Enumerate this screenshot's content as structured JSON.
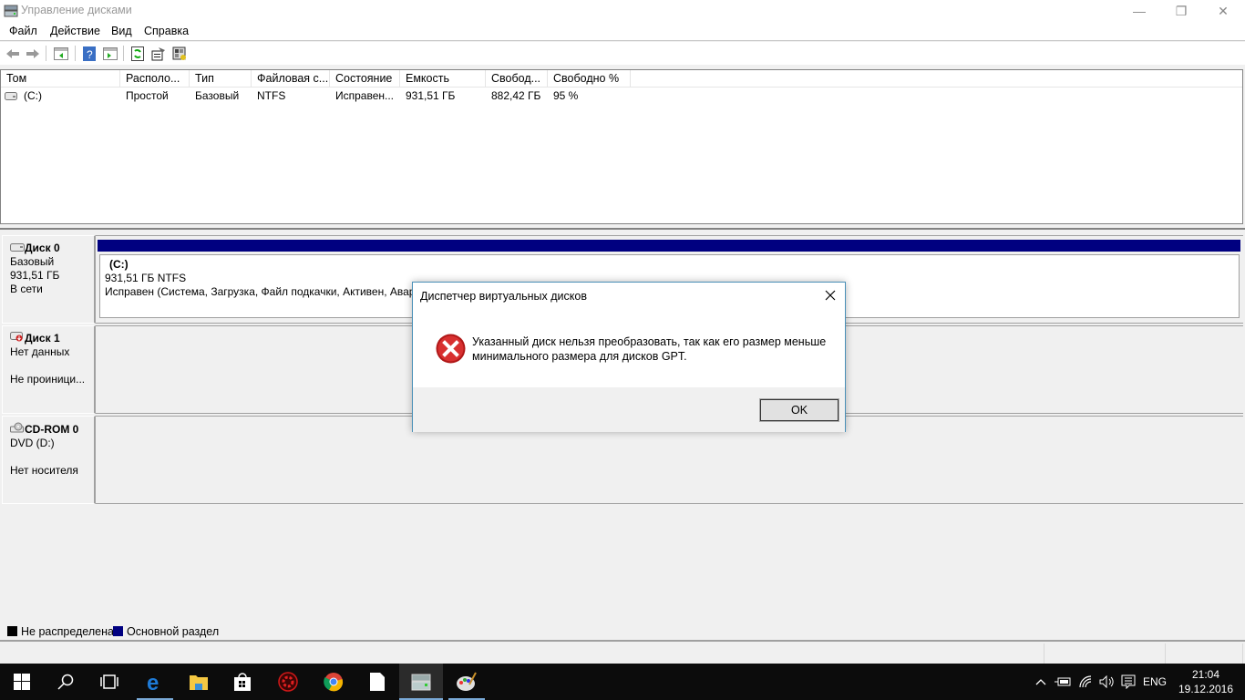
{
  "window": {
    "title": "Управление дисками",
    "controls": {
      "minimize": "—",
      "restore": "❐",
      "close": "✕"
    }
  },
  "menu": [
    "Файл",
    "Действие",
    "Вид",
    "Справка"
  ],
  "toolbar": {
    "icons": [
      "back-icon",
      "forward-icon",
      "show-hide-console-tree-icon",
      "help-icon",
      "show-hide-action-pane-icon",
      "refresh-icon",
      "properties-icon",
      "settings-icon"
    ]
  },
  "volume_list": {
    "columns": [
      "Том",
      "Располо...",
      "Тип",
      "Файловая с...",
      "Состояние",
      "Емкость",
      "Свобод...",
      "Свободно %"
    ],
    "rows": [
      {
        "volume": "(C:)",
        "layout": "Простой",
        "type": "Базовый",
        "fs": "NTFS",
        "status": "Исправен...",
        "capacity": "931,51 ГБ",
        "free": "882,42 ГБ",
        "free_pct": "95 %"
      }
    ]
  },
  "disks": [
    {
      "name": "Диск 0",
      "type": "Базовый",
      "size": "931,51 ГБ",
      "state": "В сети",
      "partition": {
        "label": "(C:)",
        "size_fs": "931,51 ГБ NTFS",
        "status": "Исправен (Система, Загрузка, Файл подкачки, Активен, Авари"
      }
    },
    {
      "name": "Диск 1",
      "type": "Нет данных",
      "state": "Не проиници..."
    },
    {
      "name": "CD-ROM 0",
      "type": "DVD (D:)",
      "state": "Нет носителя"
    }
  ],
  "legend": [
    {
      "label": "Не распределена",
      "color": "#000000"
    },
    {
      "label": "Основной раздел",
      "color": "#000080"
    }
  ],
  "dialog": {
    "title": "Диспетчер виртуальных дисков",
    "message": "Указанный диск нельзя преобразовать, так как его размер меньше минимального размера для дисков GPT.",
    "ok_label": "OK"
  },
  "taskbar": {
    "apps": [
      "start",
      "search",
      "task-view",
      "edge",
      "file-explorer",
      "store",
      "app-red",
      "chrome",
      "notepad",
      "disk-management",
      "paint"
    ],
    "tray": {
      "language": "ENG",
      "time": "21:04",
      "date": "19.12.2016"
    }
  }
}
